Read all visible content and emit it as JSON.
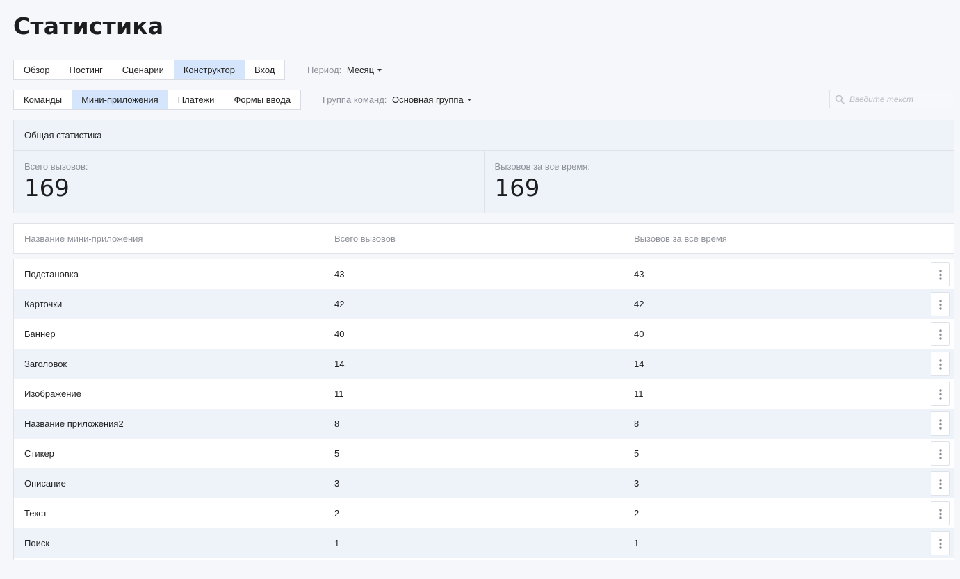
{
  "page": {
    "title": "Статистика"
  },
  "tabs_main": {
    "items": [
      "Обзор",
      "Постинг",
      "Сценарии",
      "Конструктор",
      "Вход"
    ],
    "active": "Конструктор"
  },
  "period": {
    "label": "Период:",
    "value": "Месяц"
  },
  "tabs_sub": {
    "items": [
      "Команды",
      "Мини-приложения",
      "Платежи",
      "Формы ввода"
    ],
    "active": "Мини-приложения"
  },
  "command_group": {
    "label": "Группа команд:",
    "value": "Основная группа"
  },
  "search": {
    "placeholder": "Введите текст",
    "icon": "search-icon"
  },
  "summary": {
    "title": "Общая статистика",
    "total_label": "Всего вызовов:",
    "total_value": "169",
    "alltime_label": "Вызовов за все время:",
    "alltime_value": "169"
  },
  "table": {
    "columns": [
      "Название мини-приложения",
      "Всего вызовов",
      "Вызовов за все время"
    ],
    "rows": [
      {
        "name": "Подстановка",
        "total": "43",
        "alltime": "43"
      },
      {
        "name": "Карточки",
        "total": "42",
        "alltime": "42"
      },
      {
        "name": "Баннер",
        "total": "40",
        "alltime": "40"
      },
      {
        "name": "Заголовок",
        "total": "14",
        "alltime": "14"
      },
      {
        "name": "Изображение",
        "total": "11",
        "alltime": "11"
      },
      {
        "name": "Название приложения2",
        "total": "8",
        "alltime": "8"
      },
      {
        "name": "Стикер",
        "total": "5",
        "alltime": "5"
      },
      {
        "name": "Описание",
        "total": "3",
        "alltime": "3"
      },
      {
        "name": "Текст",
        "total": "2",
        "alltime": "2"
      },
      {
        "name": "Поиск",
        "total": "1",
        "alltime": "1"
      }
    ],
    "row_menu_icon": "more-vertical-icon"
  },
  "colors": {
    "active_tab": "#d5e5fb",
    "row_alt": "#eef2f9",
    "border": "#dfe2e8"
  }
}
